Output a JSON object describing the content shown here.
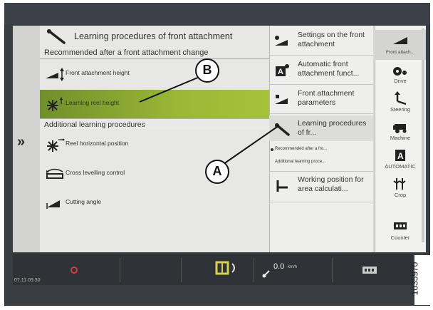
{
  "left_panel": {
    "title": "Learning procedures of front attachment",
    "subtitle": "Recommended after a front attachment change",
    "recommended_items": [
      {
        "label": "Front attachment height",
        "icon": "attachment-height-icon",
        "selected": false
      },
      {
        "label": "Learning reel height",
        "icon": "reel-height-icon",
        "selected": true
      }
    ],
    "additional_header": "Additional learning procedures",
    "additional_items": [
      {
        "label": "Reel horizontal position",
        "icon": "reel-horizontal-icon"
      },
      {
        "label": "Cross levelling control",
        "icon": "cross-levelling-icon"
      },
      {
        "label": "Cutting angle",
        "icon": "cutting-angle-icon"
      }
    ]
  },
  "middle_panel": {
    "items": [
      {
        "label": "Settings on the front attachment",
        "icon": "front-attachment-settings-icon",
        "selected": false
      },
      {
        "label": "Automatic front attachment funct...",
        "icon": "automatic-function-icon",
        "selected": false
      },
      {
        "label": "Front attachment parameters",
        "icon": "parameters-icon",
        "selected": false
      },
      {
        "label": "Learning procedures of fr...",
        "icon": "learning-procedures-icon",
        "selected": true
      },
      {
        "label": "Working position for area calculati...",
        "icon": "working-position-icon",
        "selected": false
      }
    ],
    "sub_items": [
      "Recommended after a fro...",
      "Additional learning proce..."
    ]
  },
  "right_nav": {
    "items": [
      {
        "label": "Front attach...",
        "icon": "front-attachment-icon",
        "selected": true
      },
      {
        "label": "Drive",
        "icon": "drive-icon",
        "selected": false
      },
      {
        "label": "Steering",
        "icon": "steering-icon",
        "selected": false
      },
      {
        "label": "Machine",
        "icon": "machine-icon",
        "selected": false
      },
      {
        "label": "AUTOMATIC",
        "icon": "automatic-icon",
        "selected": false
      },
      {
        "label": "Crop",
        "icon": "crop-icon",
        "selected": false
      },
      {
        "label": "Counter",
        "icon": "counter-icon",
        "selected": false
      }
    ]
  },
  "status_bar": {
    "time": "07.11  05:30",
    "speed": "0.0",
    "speed_unit": "km/h"
  },
  "callouts": {
    "a": "A",
    "b": "B"
  },
  "figure_number": "1035970",
  "colors": {
    "selected_row": "#9ab736",
    "bezel": "#3a3d42",
    "panel": "#e7e7e5"
  }
}
